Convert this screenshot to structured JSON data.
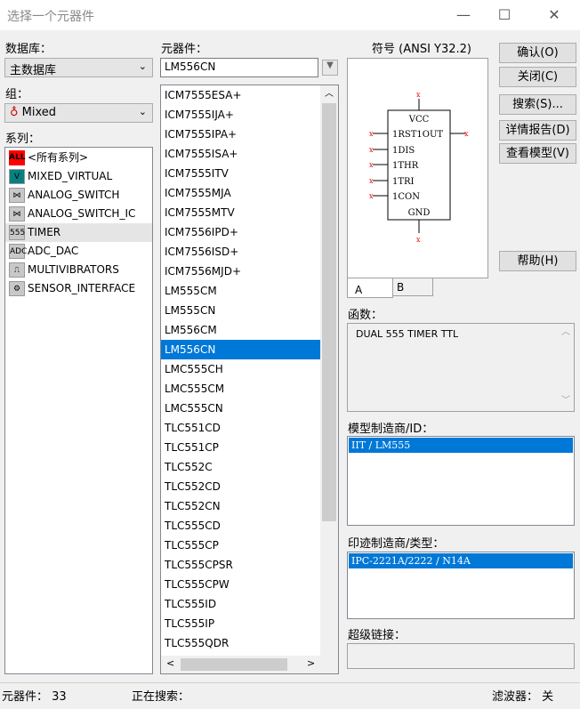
{
  "window": {
    "title": "选择一个元器件",
    "minimize": "—",
    "maximize": "☐",
    "close": "✕"
  },
  "database": {
    "label": "数据库：",
    "value": "主数据库"
  },
  "group": {
    "label": "组：",
    "value": "Mixed"
  },
  "family": {
    "label": "系列：",
    "items": [
      {
        "icon": "ALL",
        "label": "<所有系列>"
      },
      {
        "icon": "V",
        "label": "MIXED_VIRTUAL"
      },
      {
        "icon": "⋈",
        "label": "ANALOG_SWITCH"
      },
      {
        "icon": "⋈",
        "label": "ANALOG_SWITCH_IC"
      },
      {
        "icon": "555",
        "label": "TIMER"
      },
      {
        "icon": "ADC",
        "label": "ADC_DAC"
      },
      {
        "icon": "⎍",
        "label": "MULTIVIBRATORS"
      },
      {
        "icon": "⚙",
        "label": "SENSOR_INTERFACE"
      }
    ],
    "selected": "TIMER"
  },
  "component": {
    "label": "元器件：",
    "search_value": "LM556CN",
    "items": [
      "ICM7555ESA+",
      "ICM7555IJA+",
      "ICM7555IPA+",
      "ICM7555ISA+",
      "ICM7555ITV",
      "ICM7555MJA",
      "ICM7555MTV",
      "ICM7556IPD+",
      "ICM7556ISD+",
      "ICM7556MJD+",
      "LM555CM",
      "LM555CN",
      "LM556CM",
      "LM556CN",
      "LMC555CH",
      "LMC555CM",
      "LMC555CN",
      "TLC551CD",
      "TLC551CP",
      "TLC552C",
      "TLC552CD",
      "TLC552CN",
      "TLC555CD",
      "TLC555CP",
      "TLC555CPSR",
      "TLC555CPW",
      "TLC555ID",
      "TLC555IP",
      "TLC555QDR"
    ],
    "selected": "LM556CN"
  },
  "symbol": {
    "label": "符号 (ANSI Y32.2)",
    "pins": {
      "top": "VCC",
      "left": [
        "1RST1OUT",
        "1DIS",
        "1THR",
        "1TRI",
        "1CON"
      ],
      "bottom": "GND"
    },
    "tabs": [
      "A",
      "B"
    ]
  },
  "function": {
    "label": "函数：",
    "value": "DUAL 555 TIMER TTL"
  },
  "model": {
    "label": "模型制造商/ID：",
    "value": "IIT / LM555"
  },
  "footprint": {
    "label": "印迹制造商/类型：",
    "value": "IPC-2221A/2222 / N14A"
  },
  "hyperlink": {
    "label": "超级链接："
  },
  "buttons": {
    "ok": "确认(O)",
    "close": "关闭(C)",
    "search": "搜索(S)...",
    "report": "详情报告(D)",
    "model": "查看模型(V)",
    "help": "帮助(H)"
  },
  "status": {
    "count": "元器件： 33",
    "searching": "正在搜索：",
    "filter": "滤波器： 关"
  }
}
